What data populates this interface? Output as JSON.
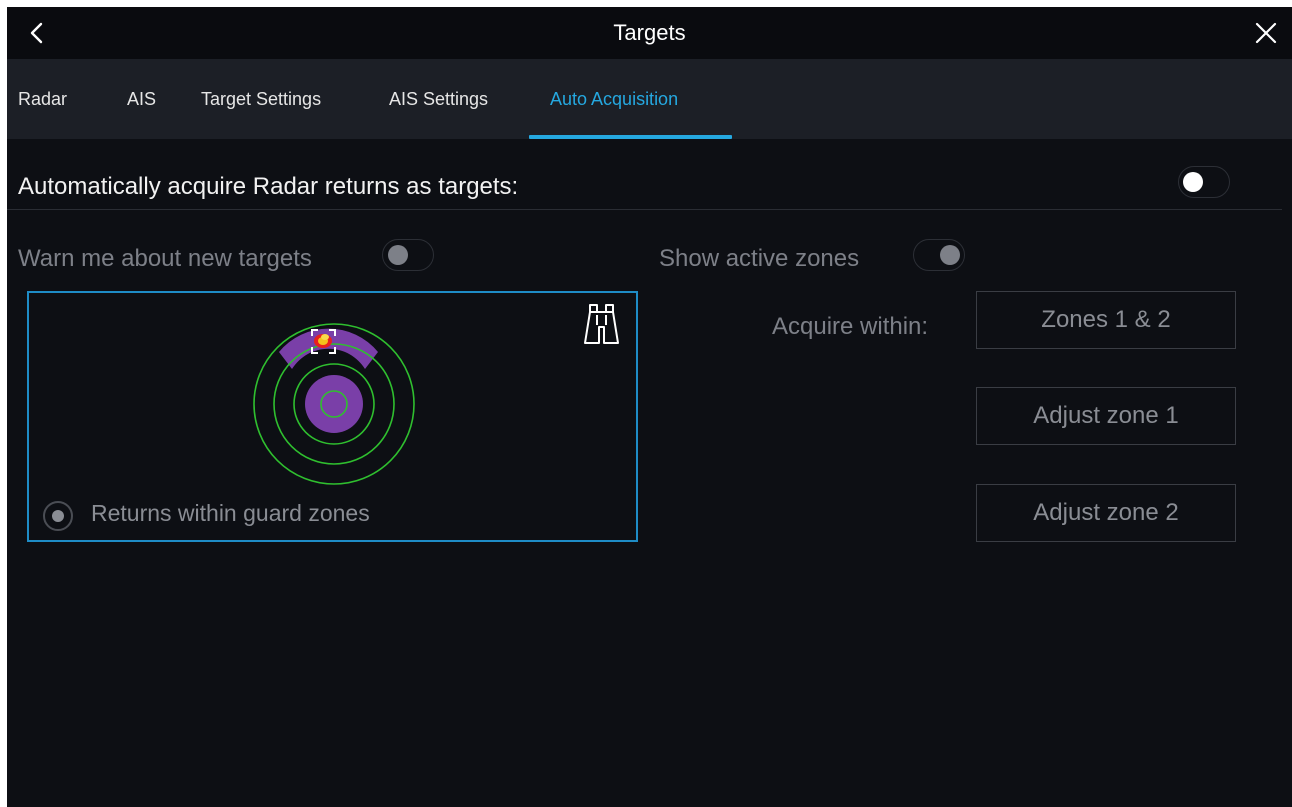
{
  "header": {
    "title": "Targets",
    "back_icon": "chevron-left-icon",
    "close_icon": "close-icon"
  },
  "tabs": [
    {
      "label": "Radar",
      "active": false
    },
    {
      "label": "AIS",
      "active": false
    },
    {
      "label": "Target Settings",
      "active": false
    },
    {
      "label": "AIS Settings",
      "active": false
    },
    {
      "label": "Auto Acquisition",
      "active": true
    }
  ],
  "auto_acquire": {
    "label": "Automatically acquire Radar returns as targets:",
    "enabled": true
  },
  "warn_new_targets": {
    "label": "Warn me about new targets",
    "enabled": false
  },
  "show_active_zones": {
    "label": "Show active zones",
    "enabled": true
  },
  "guard_zone_panel": {
    "option_label": "Returns within guard zones",
    "option_selected": true,
    "icon": "binoculars-icon"
  },
  "acquire_within": {
    "label": "Acquire within:",
    "value": "Zones 1 & 2"
  },
  "buttons": {
    "adjust_zone_1": "Adjust zone 1",
    "adjust_zone_2": "Adjust zone 2"
  },
  "colors": {
    "accent": "#25a8e0",
    "zone_fill": "#7a3fa8",
    "ring": "#2fbf2f"
  }
}
